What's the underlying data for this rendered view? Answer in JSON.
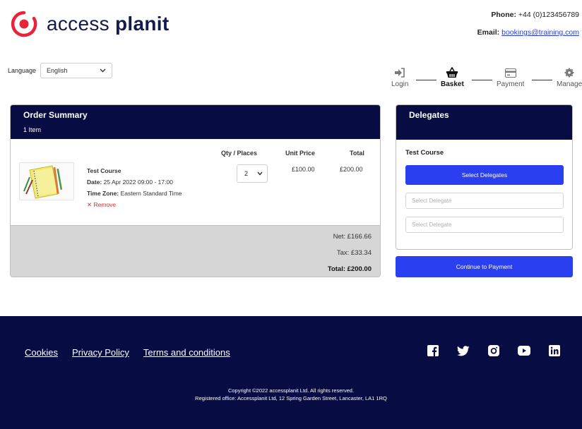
{
  "brand": {
    "name_light": "access ",
    "name_bold": "planit",
    "accent": "#e8243c",
    "navy": "#070c43"
  },
  "contact": {
    "phone_label": "Phone:",
    "phone": "+44 (0)123456789",
    "email_label": "Email:",
    "email": "bookings@training.com"
  },
  "language": {
    "label": "Language",
    "value": "English"
  },
  "steps": [
    {
      "label": "Login",
      "icon": "login-icon"
    },
    {
      "label": "Basket",
      "icon": "basket-icon",
      "active": true
    },
    {
      "label": "Payment",
      "icon": "card-icon"
    },
    {
      "label": "Manage",
      "icon": "gear-icon"
    }
  ],
  "order": {
    "title": "Order Summary",
    "subtitle": "1 Item",
    "columns": {
      "qty": "Qty / Places",
      "unit_price": "Unit Price",
      "total": "Total"
    },
    "item": {
      "name": "Test Course",
      "date_label": "Date:",
      "date": "25 Apr 2022 09:00 - 17:00",
      "tz_label": "Time Zone:",
      "tz": "Eastern Standard Time",
      "remove": "Remove",
      "qty": "2",
      "unit_price": "£100.00",
      "total": "£200.00"
    },
    "net": "Net: £166.66",
    "tax": "Tax: £33.34",
    "grand_total": "Total: £200.00"
  },
  "delegates": {
    "title": "Delegates",
    "course": "Test Course",
    "select_button": "Select Delegates",
    "placeholder_1": "Select Delegate",
    "placeholder_2": "Select Delegate"
  },
  "continue_button": "Continue to Payment",
  "footer": {
    "links": [
      "Cookies",
      "Privacy Policy",
      "Terms and conditions"
    ],
    "social": [
      "facebook-icon",
      "twitter-icon",
      "instagram-icon",
      "youtube-icon",
      "linkedin-icon"
    ],
    "copyright": "Copyright ©2022 accessplanit Ltd. All rights reserved.",
    "registered": "Registered office: Accessplanit Ltd, 12 Spring Garden Street, Lancaster, LA1 1RQ"
  }
}
